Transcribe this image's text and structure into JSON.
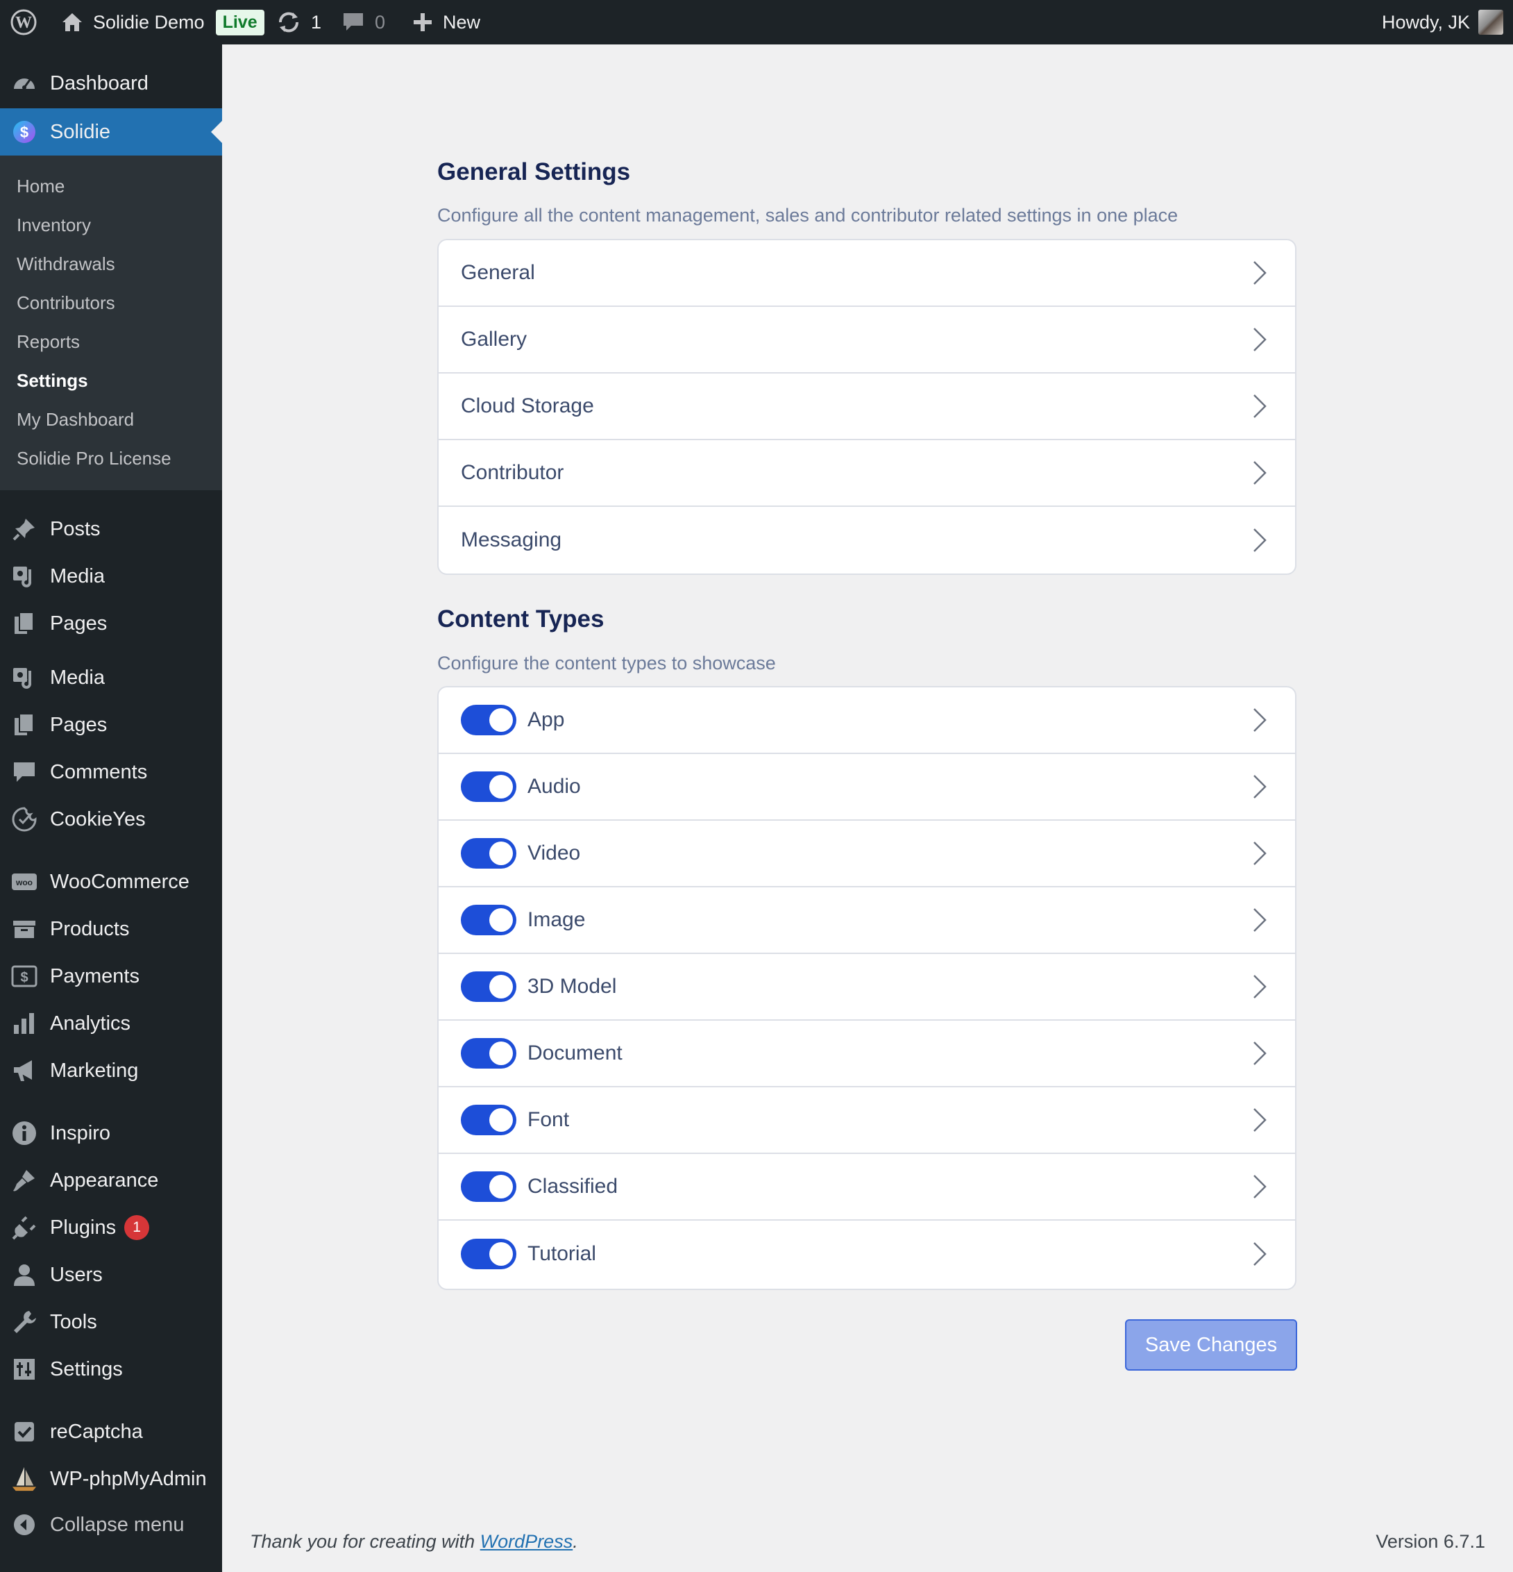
{
  "adminbar": {
    "site_name": "Solidie Demo",
    "live_badge": "Live",
    "updates_count": "1",
    "comments_count": "0",
    "new_label": "New",
    "howdy": "Howdy, JK"
  },
  "sidebar": {
    "dashboard": "Dashboard",
    "solidie": "Solidie",
    "submenu": [
      "Home",
      "Inventory",
      "Withdrawals",
      "Contributors",
      "Reports",
      "Settings",
      "My Dashboard",
      "Solidie Pro License"
    ],
    "items": [
      {
        "label": "Posts",
        "icon": "pin-icon"
      },
      {
        "label": "Media",
        "icon": "media-icon"
      },
      {
        "label": "Pages",
        "icon": "pages-icon"
      },
      {
        "label": "Media",
        "icon": "media-icon"
      },
      {
        "label": "Pages",
        "icon": "pages-icon"
      },
      {
        "label": "Comments",
        "icon": "comment-icon"
      },
      {
        "label": "CookieYes",
        "icon": "cookieyes-icon"
      },
      {
        "label": "WooCommerce",
        "icon": "woo-icon"
      },
      {
        "label": "Products",
        "icon": "archive-icon"
      },
      {
        "label": "Payments",
        "icon": "dollar-icon"
      },
      {
        "label": "Analytics",
        "icon": "bar-chart-icon"
      },
      {
        "label": "Marketing",
        "icon": "megaphone-icon"
      },
      {
        "label": "Inspiro",
        "icon": "info-icon"
      },
      {
        "label": "Appearance",
        "icon": "brush-icon"
      },
      {
        "label": "Plugins",
        "icon": "plug-icon",
        "badge": "1"
      },
      {
        "label": "Users",
        "icon": "user-icon"
      },
      {
        "label": "Tools",
        "icon": "wrench-icon"
      },
      {
        "label": "Settings",
        "icon": "sliders-icon"
      },
      {
        "label": "reCaptcha",
        "icon": "checkbox-icon"
      },
      {
        "label": "WP-phpMyAdmin",
        "icon": "sailboat-icon"
      }
    ],
    "collapse": "Collapse menu"
  },
  "general": {
    "title": "General Settings",
    "description": "Configure all the content management, sales and contributor related settings in one place",
    "rows": [
      "General",
      "Gallery",
      "Cloud Storage",
      "Contributor",
      "Messaging"
    ]
  },
  "content_types": {
    "title": "Content Types",
    "description": "Configure the content types to showcase",
    "rows": [
      {
        "label": "App",
        "enabled": true
      },
      {
        "label": "Audio",
        "enabled": true
      },
      {
        "label": "Video",
        "enabled": true
      },
      {
        "label": "Image",
        "enabled": true
      },
      {
        "label": "3D Model",
        "enabled": true
      },
      {
        "label": "Document",
        "enabled": true
      },
      {
        "label": "Font",
        "enabled": true
      },
      {
        "label": "Classified",
        "enabled": true
      },
      {
        "label": "Tutorial",
        "enabled": true
      }
    ]
  },
  "save_label": "Save Changes",
  "footer": {
    "thanks_prefix": "Thank you for creating with ",
    "wordpress_link": "WordPress",
    "thanks_suffix": ".",
    "version": "Version 6.7.1"
  },
  "colors": {
    "adminbar_bg": "#1d2327",
    "menu_active": "#2271b1",
    "toggle_on": "#1d4ed8",
    "save_button": "#8ba5ea",
    "badge_red": "#d63638"
  }
}
